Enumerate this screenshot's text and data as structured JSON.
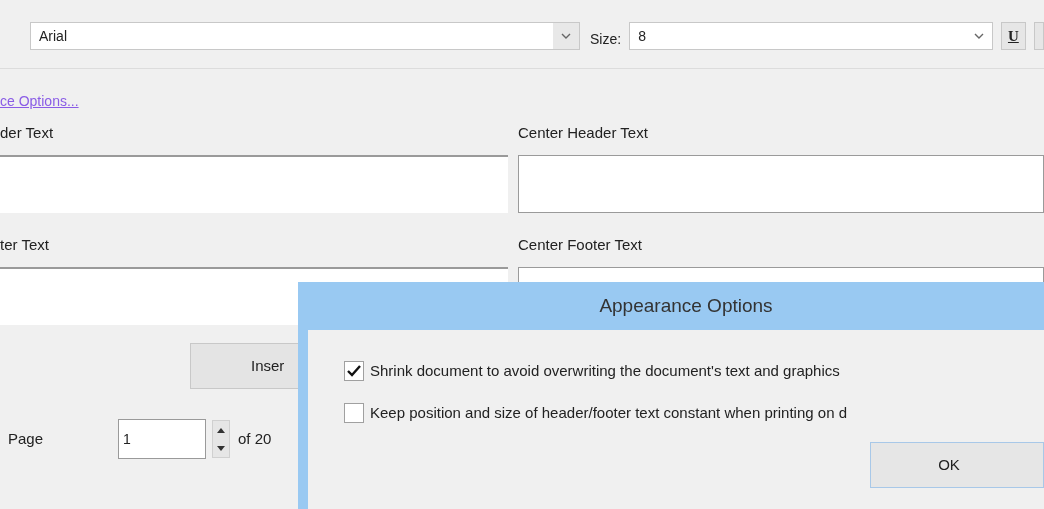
{
  "toolbar": {
    "font": "Arial",
    "size_label": "Size:",
    "size": "8",
    "underline_button": "U"
  },
  "link": "ce Options...",
  "fields": [
    {
      "label": "der Text"
    },
    {
      "label": "Center Header Text"
    },
    {
      "label": "ter Text"
    },
    {
      "label": "Center Footer Text"
    }
  ],
  "insert_button": "Inser",
  "page": {
    "label": "Page",
    "value": "1",
    "of": "of 20"
  },
  "dialog": {
    "title": "Appearance Options",
    "options": [
      {
        "label": "Shrink document to avoid overwriting  the document's text and graphics",
        "checked": true
      },
      {
        "label": "Keep position and size of header/footer text constant when printing on d",
        "checked": false
      }
    ],
    "ok": "OK"
  }
}
